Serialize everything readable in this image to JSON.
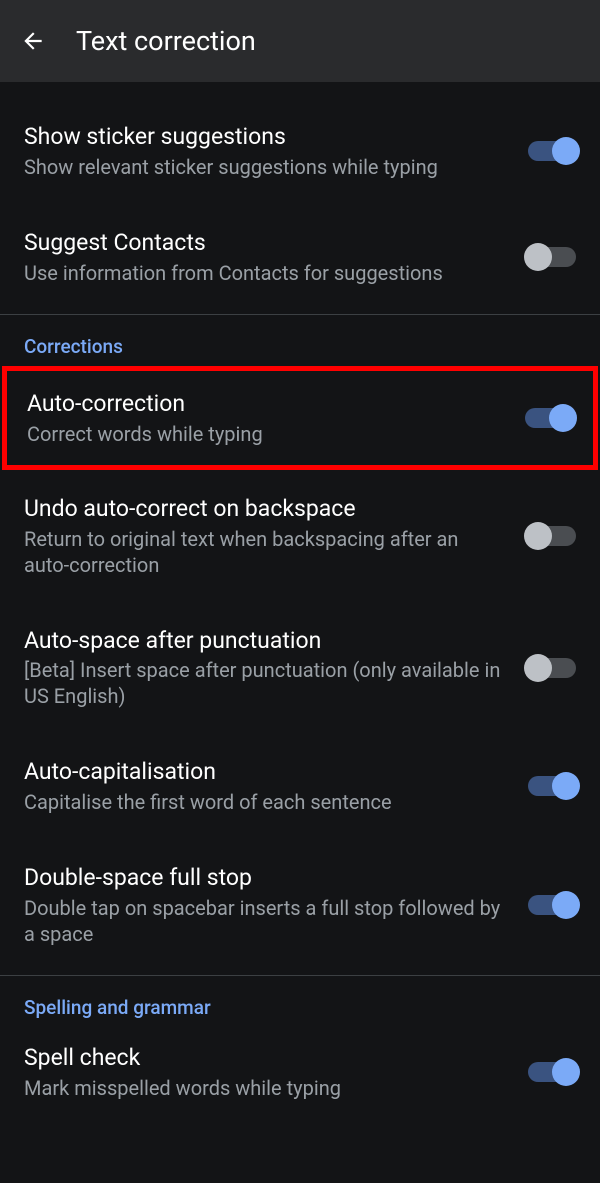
{
  "header": {
    "title": "Text correction"
  },
  "items": [
    {
      "id": "sticker",
      "title": "Show sticker suggestions",
      "subtitle": "Show relevant sticker suggestions while typing",
      "on": true
    },
    {
      "id": "contacts",
      "title": "Suggest Contacts",
      "subtitle": "Use information from Contacts for suggestions",
      "on": false
    }
  ],
  "sections": [
    {
      "header": "Corrections",
      "items": [
        {
          "id": "autocorrect",
          "title": "Auto-correction",
          "subtitle": "Correct words while typing",
          "on": true,
          "highlighted": true
        },
        {
          "id": "undo",
          "title": "Undo auto-correct on backspace",
          "subtitle": "Return to original text when backspacing after an auto-correction",
          "on": false
        },
        {
          "id": "autospace",
          "title": "Auto-space after punctuation",
          "subtitle": "[Beta] Insert space after punctuation (only available in US English)",
          "on": false
        },
        {
          "id": "autocap",
          "title": "Auto-capitalisation",
          "subtitle": "Capitalise the first word of each sentence",
          "on": true
        },
        {
          "id": "doublespace",
          "title": "Double-space full stop",
          "subtitle": "Double tap on spacebar inserts a full stop followed by a space",
          "on": true
        }
      ]
    },
    {
      "header": "Spelling and grammar",
      "items": [
        {
          "id": "spellcheck",
          "title": "Spell check",
          "subtitle": "Mark misspelled words while typing",
          "on": true
        }
      ]
    }
  ]
}
